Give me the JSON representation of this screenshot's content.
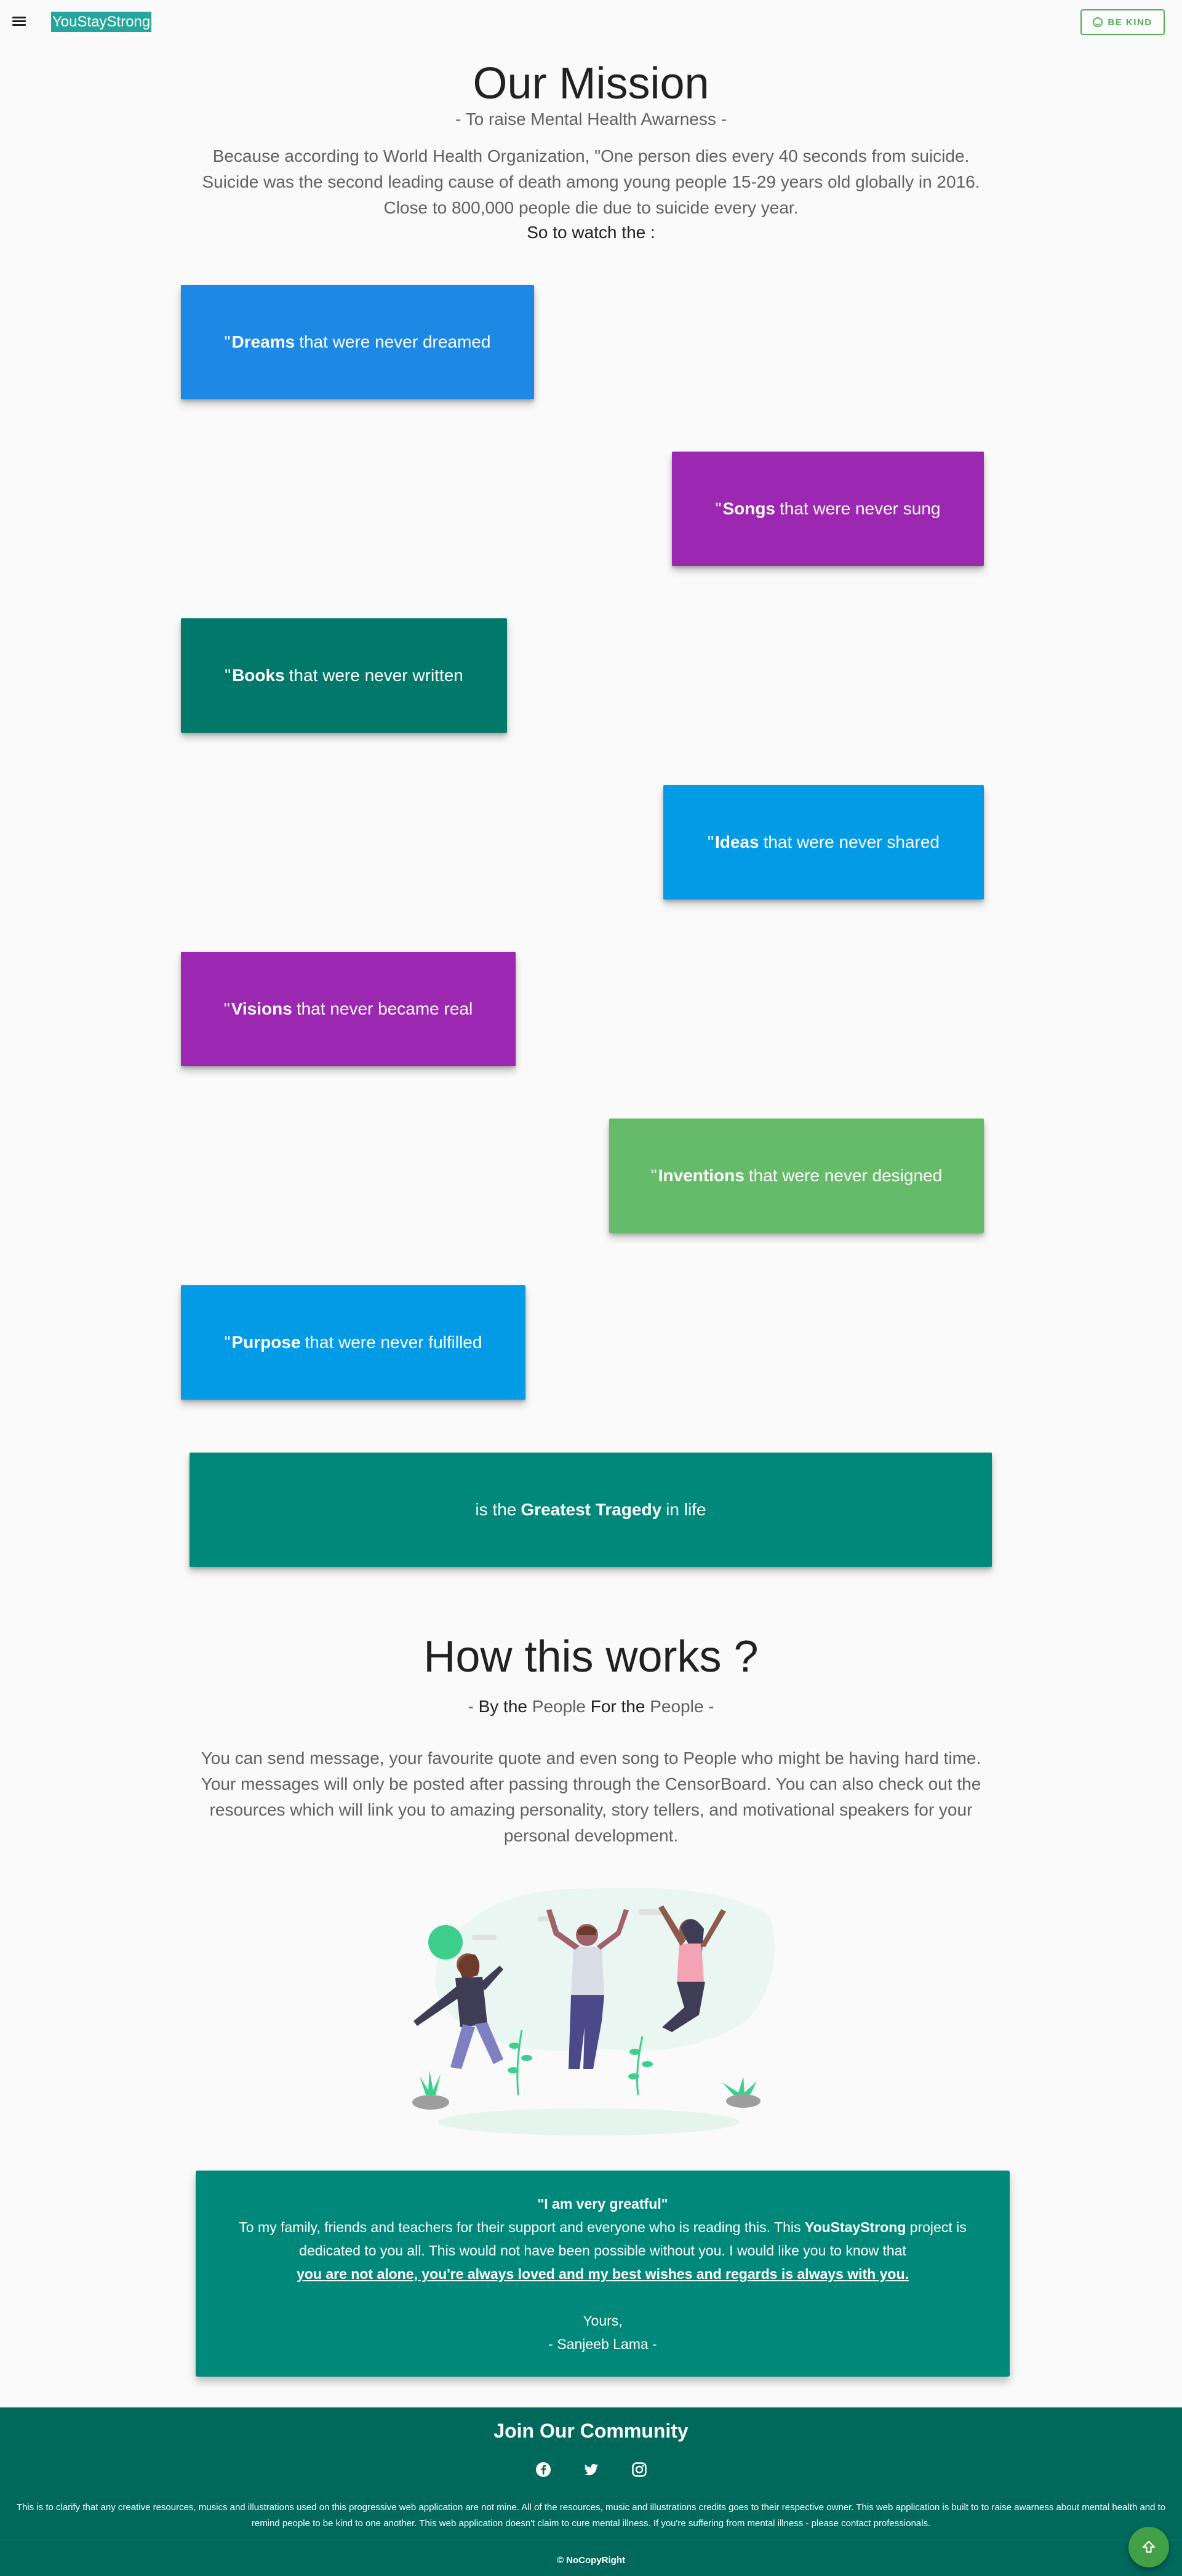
{
  "header": {
    "brand": "YouStayStrong",
    "be_kind_label": "BE KIND"
  },
  "mission": {
    "title": "Our Mission",
    "subtitle": "- To raise Mental Health Awarness -",
    "intro_lines": [
      "Because according to World Health Organization, \"One person dies every 40 seconds from suicide.",
      "Suicide was the second leading cause of death among young people 15-29 years old globally in 2016.",
      "Close to 800,000 people die due to suicide every year."
    ],
    "watch": "So to watch the :",
    "cards": [
      {
        "prefix": "\"",
        "bold": "Dreams",
        "rest": "that were never dreamed",
        "color": "#1e88e5"
      },
      {
        "prefix": "\"",
        "bold": "Songs",
        "rest": "that were never sung",
        "color": "#9c27b0"
      },
      {
        "prefix": "\"",
        "bold": "Books",
        "rest": "that were never written",
        "color": "#00796b"
      },
      {
        "prefix": "\"",
        "bold": "Ideas",
        "rest": "that were never shared",
        "color": "#039be5"
      },
      {
        "prefix": "\"",
        "bold": "Visions",
        "rest": "that never became real",
        "color": "#9c27b0"
      },
      {
        "prefix": "\"",
        "bold": "Inventions",
        "rest": "that were never designed",
        "color": "#66bb6a"
      },
      {
        "prefix": "\"",
        "bold": "Purpose",
        "rest": "that were never fulfilled",
        "color": "#039be5"
      }
    ],
    "tragedy": {
      "before": "is the",
      "bold": "Greatest Tragedy",
      "after": "in life",
      "color": "#00897b"
    }
  },
  "how": {
    "title": "How this works ?",
    "subtitle": {
      "dash1": "- ",
      "by": "By the",
      "people1": "People",
      "for": "For the",
      "people2": "People",
      "dash2": " -"
    },
    "text": "You can send message, your favourite quote and even song to People who might be having hard time. Your messages will only be posted after passing through the CensorBoard. You can also check out the resources which will link you to amazing personality, story tellers, and motivational speakers for your personal development."
  },
  "grateful": {
    "quote": "\"I am very greatful\"",
    "line1_start": "To my family, friends and teachers for their support and everyone who is reading this. This ",
    "line1_bold": "YouStayStrong",
    "line1_end": " project is",
    "line2": "dedicated to you all. This would not have been possible without you. I would like you to know that",
    "line3": "you are not alone, you're always loved and my best wishes and regards is always with you.",
    "yours": "Yours,",
    "signature": "- Sanjeeb Lama -"
  },
  "footer": {
    "join": "Join Our Community",
    "social_icons": [
      "facebook-icon",
      "twitter-icon",
      "instagram-icon"
    ],
    "disclaimer": "This is to clarify that any creative resources, musics and illustrations used on this progressive web application are not mine. All of the resources, music and illustrations credits goes to their respective owner. This web application is built to to raise awarness about mental health and to remind people to be kind to one another. This web application doesn't claim to cure mental illness. If you're suffering from mental illness - please contact professionals.",
    "copyright": "© NoCopyRight"
  },
  "colors": {
    "brand": "#26a69a",
    "accent_green": "#4caf50",
    "footer_bg": "#00695c",
    "grateful_bg": "#00897b"
  }
}
